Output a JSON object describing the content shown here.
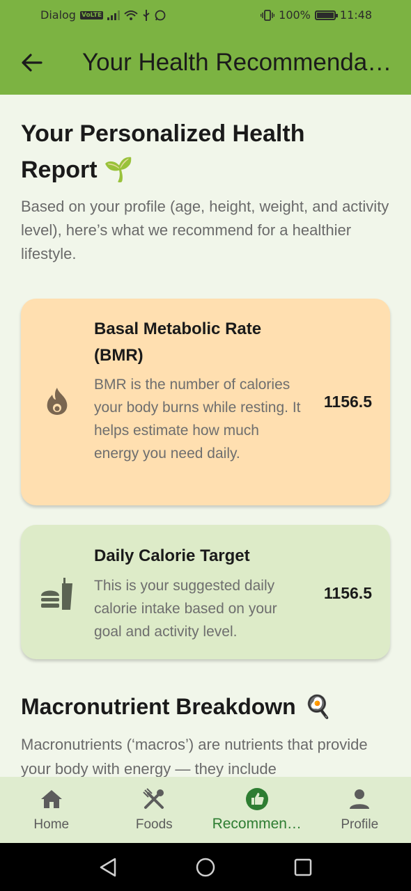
{
  "status_bar": {
    "carrier": "Dialog",
    "volte": "VoLTE",
    "battery": "100%",
    "time": "11:48"
  },
  "app_bar": {
    "title": "Your Health Recommenda…"
  },
  "report": {
    "title": "Your Personalized Health Report 🌱",
    "intro": "Based on your profile (age, height, weight, and activity level), here’s what we recommend for a healthier lifestyle."
  },
  "cards": {
    "bmr": {
      "title": "Basal Metabolic Rate (BMR)",
      "description": "BMR is the number of calories your body burns while resting. It helps estimate how much energy you need daily.",
      "value": "1156.5",
      "icon": "fire-icon",
      "color": "#ffdfb0"
    },
    "calories": {
      "title": "Daily Calorie Target",
      "description": "This is your suggested daily calorie intake based on your goal and activity level.",
      "value": "1156.5",
      "icon": "fastfood-icon",
      "color": "#ddebc8"
    }
  },
  "macros": {
    "title": "Macronutrient Breakdown",
    "title_emoji": "🍳",
    "description": "Macronutrients (‘macros’) are nutrients that provide your body with energy — they include"
  },
  "bottom_nav": {
    "items": [
      {
        "label": "Home",
        "icon": "home-icon",
        "active": false
      },
      {
        "label": "Foods",
        "icon": "utensils-icon",
        "active": false
      },
      {
        "label": "Recommen…",
        "icon": "thumbs-up-icon",
        "active": true
      },
      {
        "label": "Profile",
        "icon": "person-icon",
        "active": false
      }
    ]
  },
  "colors": {
    "primary": "#7cb342",
    "active_nav": "#2e7d32",
    "background": "#f1f6ea"
  }
}
